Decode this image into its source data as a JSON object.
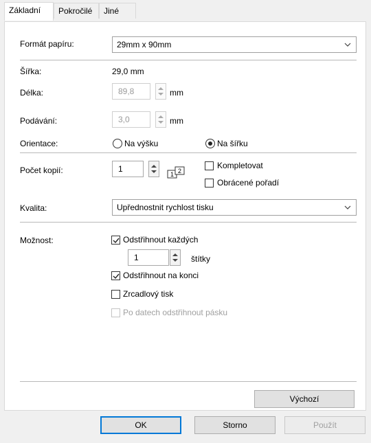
{
  "tabs": [
    {
      "label": "Základní",
      "active": true
    },
    {
      "label": "Pokročilé",
      "active": false
    },
    {
      "label": "Jiné",
      "active": false
    }
  ],
  "paper_format": {
    "label": "Formát papíru:",
    "value": "29mm x 90mm"
  },
  "width": {
    "label": "Šířka:",
    "value": "29,0 mm"
  },
  "length": {
    "label": "Délka:",
    "value": "89,8",
    "unit": "mm"
  },
  "feed": {
    "label": "Podávání:",
    "value": "3,0",
    "unit": "mm"
  },
  "orientation": {
    "label": "Orientace:",
    "portrait": "Na výšku",
    "landscape": "Na šířku",
    "selected": "landscape"
  },
  "copies": {
    "label": "Počet kopií:",
    "value": "1",
    "collate": "Kompletovat",
    "reverse": "Obrácené pořadí"
  },
  "quality": {
    "label": "Kvalita:",
    "value": "Upřednostnit rychlost tisku"
  },
  "options": {
    "label": "Možnost:",
    "cut_every": "Odstřihnout každých",
    "cut_every_value": "1",
    "cut_every_unit": "štítky",
    "cut_at_end": "Odstřihnout na konci",
    "mirror": "Zrcadlový tisk",
    "cut_after_data": "Po datech odstřihnout pásku"
  },
  "default_button": "Výchozí",
  "ok_button": "OK",
  "cancel_button": "Storno",
  "apply_button": "Použít",
  "colors": {
    "accent": "#0078d7",
    "panel_bg": "#ffffff",
    "window_bg": "#f0f0f0"
  }
}
